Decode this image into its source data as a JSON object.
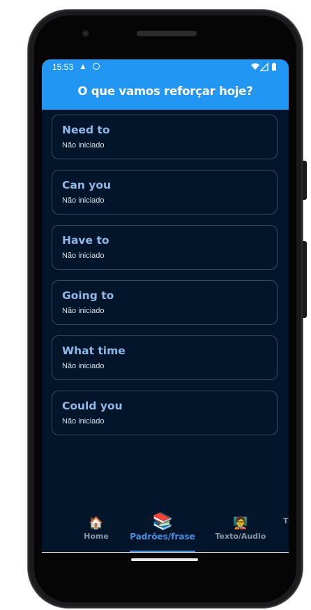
{
  "status_bar": {
    "time": "15:53",
    "alert_icon": "warning-triangle-icon",
    "sync_icon": "circle-icon",
    "wifi_icon": "wifi-icon",
    "signal_icon": "signal-icon",
    "battery_icon": "battery-icon"
  },
  "app_bar": {
    "title": "O que vamos reforçar hoje?",
    "color": "#2196f3"
  },
  "colors": {
    "background": "#02152a",
    "card_border": "#3b4a5a",
    "card_title": "#8fb8e6",
    "nav_active": "#4a90e2",
    "nav_inactive": "#8a96a3"
  },
  "patterns": [
    {
      "title": "Need to",
      "status": "Não iniciado"
    },
    {
      "title": "Can you",
      "status": "Não iniciado"
    },
    {
      "title": "Have to",
      "status": "Não iniciado"
    },
    {
      "title": "Going to",
      "status": "Não iniciado"
    },
    {
      "title": "What time",
      "status": "Não iniciado"
    },
    {
      "title": "Could you",
      "status": "Não iniciado"
    }
  ],
  "bottom_nav": {
    "items": [
      {
        "label": "Home",
        "icon": "🏠",
        "icon_name": "home-icon"
      },
      {
        "label": "Padrões/frase",
        "icon": "📚",
        "icon_name": "books-icon",
        "active": true
      },
      {
        "label": "Texto/Audio",
        "icon": "🧑‍🏫",
        "icon_name": "teacher-icon"
      },
      {
        "label": "T",
        "icon": "",
        "icon_name": "partial-icon"
      }
    ]
  }
}
